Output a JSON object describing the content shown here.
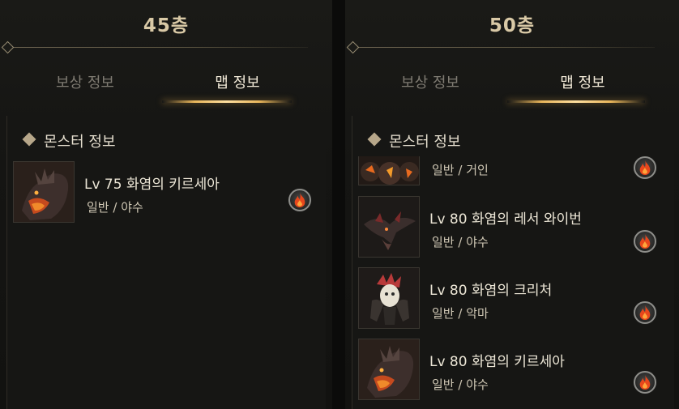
{
  "panels": {
    "left": {
      "floor_title": "45층",
      "tabs": [
        {
          "label": "보상 정보"
        },
        {
          "label": "맵 정보"
        }
      ],
      "section_title": "몬스터 정보",
      "monsters": [
        {
          "name": "Lv 75 화염의 키르세아",
          "type": "일반 / 야수",
          "element": "fire-icon"
        }
      ]
    },
    "right": {
      "floor_title": "50층",
      "tabs": [
        {
          "label": "보상 정보"
        },
        {
          "label": "맵 정보"
        }
      ],
      "section_title": "몬스터 정보",
      "monsters": [
        {
          "name": "",
          "type": "일반 / 거인",
          "element": "fire-icon"
        },
        {
          "name": "Lv 80 화염의 레서 와이번",
          "type": "일반 / 야수",
          "element": "fire-icon"
        },
        {
          "name": "Lv 80 화염의 크리처",
          "type": "일반 / 악마",
          "element": "fire-icon"
        },
        {
          "name": "Lv 80 화염의 키르세아",
          "type": "일반 / 야수",
          "element": "fire-icon"
        }
      ]
    }
  },
  "colors": {
    "accent_gold": "#e8b55a",
    "title_text": "#d9c9a6",
    "active_tab": "#f2ead8",
    "inactive_tab": "#7f7b72"
  }
}
